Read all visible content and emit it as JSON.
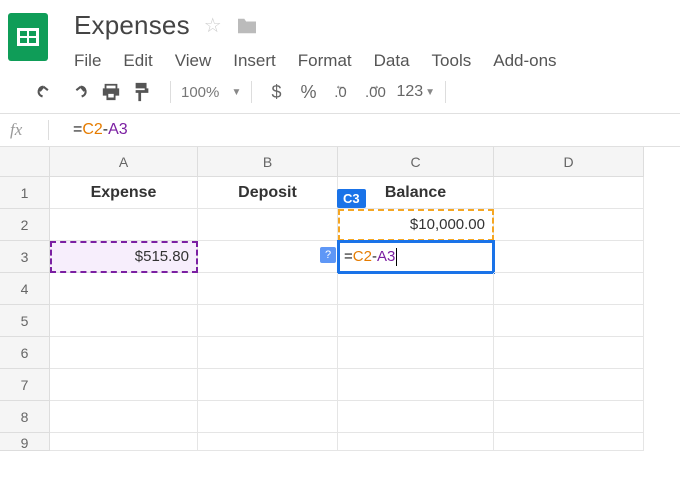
{
  "doc": {
    "title": "Expenses"
  },
  "menu": {
    "file": "File",
    "edit": "Edit",
    "view": "View",
    "insert": "Insert",
    "format": "Format",
    "data": "Data",
    "tools": "Tools",
    "addons": "Add-ons"
  },
  "toolbar": {
    "zoom": "100%",
    "dollar": "$",
    "percent": "%",
    "dec_less": ".0",
    "dec_more": ".00",
    "fmt123": "123"
  },
  "formula": {
    "eq": "=",
    "ref1": "C2",
    "op": "-",
    "ref2": "A3"
  },
  "cols": {
    "A": "A",
    "B": "B",
    "C": "C",
    "D": "D"
  },
  "rows": {
    "r1": "1",
    "r2": "2",
    "r3": "3",
    "r4": "4",
    "r5": "5",
    "r6": "6",
    "r7": "7",
    "r8": "8",
    "r9": "9"
  },
  "cells": {
    "A1": "Expense",
    "B1": "Deposit",
    "C1": "Balance",
    "C2": "$10,000.00",
    "A3": "$515.80",
    "C3_label": "C3",
    "C3_help": "?"
  }
}
